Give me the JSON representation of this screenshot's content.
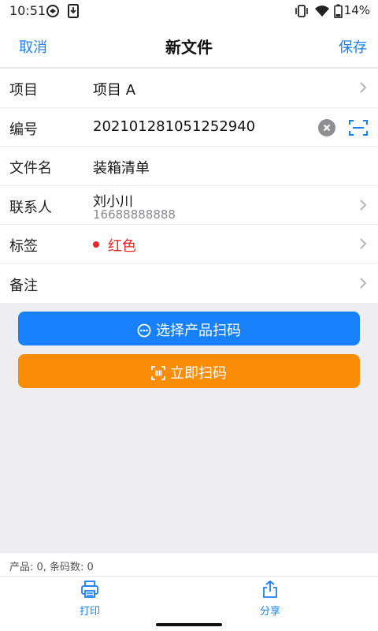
{
  "status_bar": {
    "time": "10:51",
    "battery_percent": "14%",
    "icons": [
      "data-saver-icon",
      "download-icon",
      "vibrate-icon",
      "wifi-icon",
      "battery-icon"
    ]
  },
  "nav": {
    "cancel_label": "取消",
    "title": "新文件",
    "save_label": "保存"
  },
  "form": {
    "project": {
      "label": "项目",
      "value": "项目 A"
    },
    "number": {
      "label": "编号",
      "value": "20210128105125294​0"
    },
    "filename": {
      "label": "文件名",
      "value": "装箱清单"
    },
    "contact": {
      "label": "联系人",
      "name": "刘小川",
      "phone": "16688888888"
    },
    "tag": {
      "label": "标签",
      "value": "红色",
      "color": "#e8262a"
    },
    "note": {
      "label": "备注",
      "value": ""
    }
  },
  "actions": {
    "select_scan_label": "选择产品扫码",
    "scan_now_label": "立即扫码"
  },
  "summary": {
    "text": "产品: 0, 条码数: 0"
  },
  "tabs": [
    {
      "label": "打印",
      "icon": "printer-icon"
    },
    {
      "label": "分享",
      "icon": "share-icon"
    }
  ],
  "colors": {
    "accent": "#1a7ff5",
    "primary_button": "#1781fb",
    "secondary_button": "#fb8c05",
    "tag_red": "#e8262a",
    "background": "#eeeef1"
  }
}
